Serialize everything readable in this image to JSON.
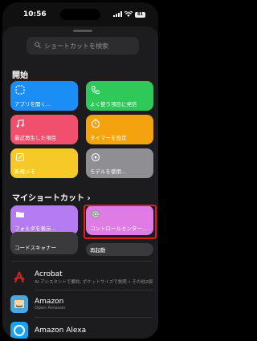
{
  "status_bar": {
    "time": "10:56",
    "battery": "81"
  },
  "search": {
    "placeholder": "ショートカットを検索"
  },
  "sections": {
    "start_title": "開始",
    "my_title": "マイショートカット",
    "my_chevron": "›"
  },
  "start_tiles": [
    {
      "label": "アプリを開く...",
      "icon": "app-square-icon",
      "color": "#1a8ef5"
    },
    {
      "label": "よく使う項目に発信",
      "icon": "phone-icon",
      "color": "#2fc95a"
    },
    {
      "label": "最近再生した項目",
      "icon": "music-note-icon",
      "color": "#f0506d"
    },
    {
      "label": "タイマーを設定",
      "icon": "timer-icon",
      "color": "#f5a20f"
    },
    {
      "label": "新規メモ",
      "icon": "note-icon",
      "color": "#f7c928"
    },
    {
      "label": "モデルを使用...",
      "icon": "model-icon",
      "color": "#8e8e93"
    }
  ],
  "my_tiles": [
    {
      "label": "フォルダを表示...",
      "icon": "folder-icon",
      "color": "#b47cf0"
    },
    {
      "label": "コントロールセンター...",
      "icon": "settings-gear-icon",
      "color": "#e07be6"
    },
    {
      "label": "コードスキャナー",
      "icon": "qr-code-icon",
      "color": "#3a3a3c"
    },
    {
      "label": "再起動",
      "icon": "power-icon",
      "color": "#3a3a3c"
    }
  ],
  "apps": [
    {
      "name": "Acrobat",
      "subtitle": "AI アシスタントで要約, ポケットサイズで質問 • その他2個",
      "icon_letter": "A",
      "color": "#d9231e"
    },
    {
      "name": "Amazon",
      "subtitle": "Open Amazon",
      "icon_letter": "a",
      "color": "#4aa8e0"
    },
    {
      "name": "Amazon Alexa",
      "subtitle": "",
      "icon_letter": "○",
      "color": "#1aa3e8"
    }
  ]
}
